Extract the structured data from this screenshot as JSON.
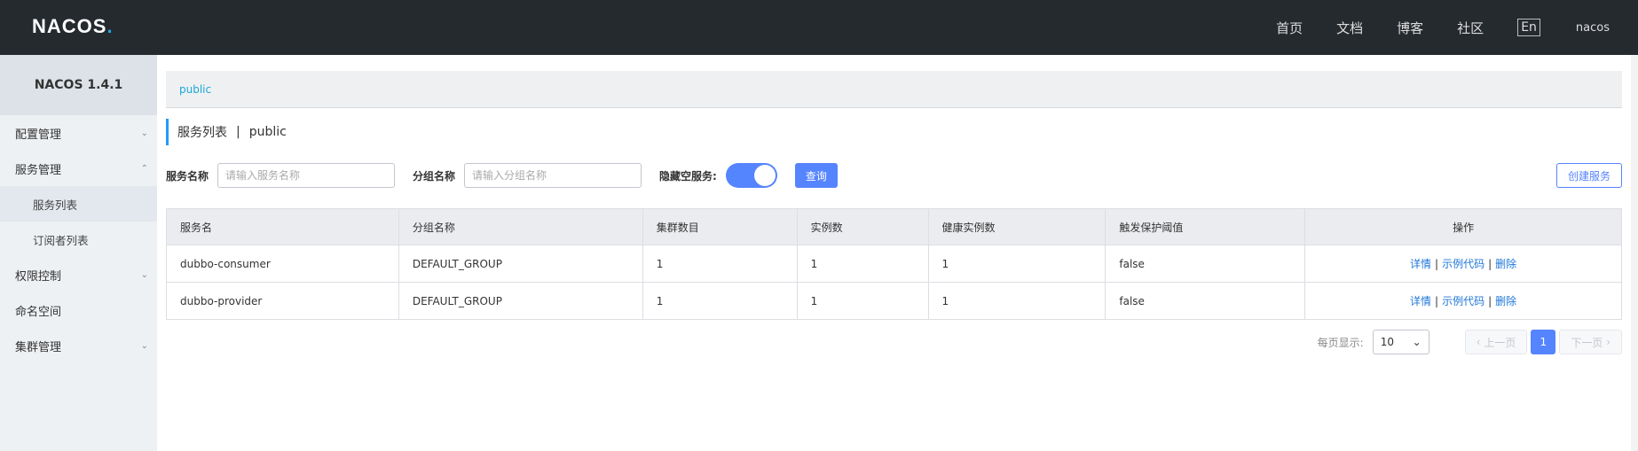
{
  "header": {
    "logo_text": "NACOS",
    "logo_dot": ".",
    "nav": [
      "首页",
      "文档",
      "博客",
      "社区"
    ],
    "lang": "En",
    "user": "nacos"
  },
  "sidebar": {
    "version": "NACOS 1.4.1",
    "items": [
      {
        "label": "配置管理",
        "chevron": "⌄"
      },
      {
        "label": "服务管理",
        "chevron": "⌃"
      },
      {
        "label": "服务列表"
      },
      {
        "label": "订阅者列表"
      },
      {
        "label": "权限控制",
        "chevron": "⌄"
      },
      {
        "label": "命名空间"
      },
      {
        "label": "集群管理",
        "chevron": "⌄"
      }
    ]
  },
  "main": {
    "namespace": "public",
    "title": "服务列表",
    "title_sep": "|",
    "title_ns": "public",
    "filters": {
      "service_label": "服务名称",
      "service_placeholder": "请输入服务名称",
      "group_label": "分组名称",
      "group_placeholder": "请输入分组名称",
      "hide_empty_label": "隐藏空服务:",
      "search_button": "查询",
      "create_button": "创建服务"
    },
    "table": {
      "headers": [
        "服务名",
        "分组名称",
        "集群数目",
        "实例数",
        "健康实例数",
        "触发保护阈值",
        "操作"
      ],
      "rows": [
        [
          "dubbo-consumer",
          "DEFAULT_GROUP",
          "1",
          "1",
          "1",
          "false"
        ],
        [
          "dubbo-provider",
          "DEFAULT_GROUP",
          "1",
          "1",
          "1",
          "false"
        ]
      ],
      "ops": {
        "detail": "详情",
        "sample": "示例代码",
        "delete": "删除",
        "sep": "|"
      }
    },
    "pager": {
      "page_size_label": "每页显示:",
      "page_size": "10",
      "prev": "上一页",
      "current": "1",
      "next": "下一页"
    }
  },
  "colors": {
    "accent": "#5584ff",
    "topbar": "#252a2f",
    "link": "#2077d8"
  }
}
